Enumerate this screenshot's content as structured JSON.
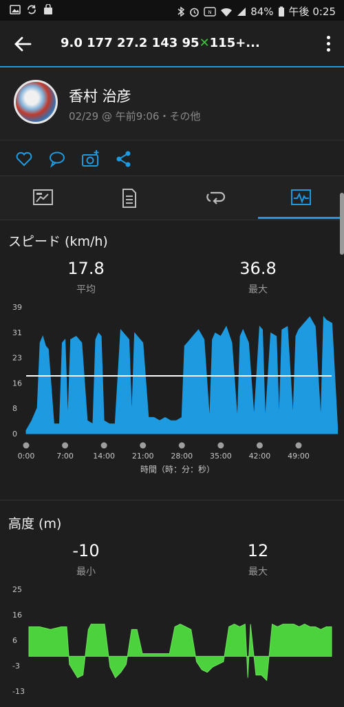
{
  "status_bar": {
    "battery": "84%",
    "time": "午後 0:25",
    "left_icons": [
      "image-icon",
      "sync-icon",
      "bag-icon"
    ],
    "right_icons": [
      "bluetooth-icon",
      "alarm-icon",
      "nfc-icon",
      "wifi-icon",
      "signal-icon",
      "battery-icon"
    ]
  },
  "app_bar": {
    "title_before": "9.0  177 27.2  143  95",
    "title_mark": "✕",
    "title_after": "115+...",
    "colors": {
      "accent": "#1e9be0",
      "mark": "#3cc43c"
    }
  },
  "profile": {
    "name": "香村 治彦",
    "meta": "02/29 @ 午前9:06・その他"
  },
  "actions": [
    "heart-icon",
    "comment-icon",
    "camera-add-icon",
    "share-icon"
  ],
  "tabs": [
    {
      "icon": "overview-icon",
      "active": false
    },
    {
      "icon": "details-icon",
      "active": false
    },
    {
      "icon": "laps-icon",
      "active": false
    },
    {
      "icon": "graphs-icon",
      "active": true
    }
  ],
  "speed": {
    "title": "スピード (km/h)",
    "avg_value": "17.8",
    "avg_label": "平均",
    "max_value": "36.8",
    "max_label": "最大",
    "x_axis_label": "時間（時：分：秒）",
    "color": "#1e9be0"
  },
  "altitude": {
    "title": "高度 (m)",
    "min_value": "-10",
    "min_label": "最小",
    "max_value": "12",
    "max_label": "最大",
    "color": "#4cd23c"
  },
  "chart_data": [
    {
      "type": "area",
      "ylim": [
        0,
        39
      ],
      "yticks": [
        "39",
        "31",
        "23",
        "16",
        "8",
        "0"
      ],
      "xticks": [
        "0:00",
        "7:00",
        "14:00",
        "21:00",
        "28:00",
        "35:00",
        "42:00",
        "49:00"
      ],
      "average_line": 17.8,
      "x_minutes": [
        0,
        1,
        2,
        2.5,
        3,
        3.5,
        4,
        5,
        6,
        6.5,
        7,
        7.5,
        8,
        9,
        10,
        11,
        12,
        12.5,
        13,
        13.5,
        14,
        15,
        16,
        17,
        18,
        18.5,
        19,
        19.5,
        20,
        21,
        22,
        23,
        24,
        25,
        26,
        27,
        28,
        28.5,
        29,
        30,
        31,
        32,
        33,
        33.5,
        34,
        35,
        36,
        37,
        38,
        38.5,
        39,
        40,
        41,
        42,
        42.5,
        43,
        44,
        45,
        45.5,
        46,
        47,
        48,
        48.5,
        49,
        50,
        51,
        52,
        53,
        53.5,
        54,
        55,
        56
      ],
      "values": [
        1,
        4,
        8,
        28,
        30,
        27,
        26,
        3,
        3,
        28,
        29,
        4,
        29,
        30,
        28,
        4,
        3,
        29,
        31,
        30,
        4,
        3,
        3,
        32,
        30,
        29,
        5,
        31,
        30,
        28,
        5,
        5,
        4,
        5,
        4,
        4,
        5,
        27,
        28,
        30,
        32,
        29,
        4,
        29,
        31,
        30,
        33,
        28,
        4,
        30,
        32,
        28,
        5,
        33,
        32,
        4,
        31,
        30,
        4,
        32,
        33,
        5,
        30,
        32,
        34,
        36,
        33,
        4,
        36,
        35,
        34,
        2
      ]
    },
    {
      "type": "area",
      "ylim": [
        -13,
        25
      ],
      "yticks": [
        "25",
        "16",
        "6",
        "-3",
        "-13"
      ],
      "x_minutes": [
        0,
        2,
        4,
        6,
        7,
        7.5,
        9,
        10,
        11,
        11.5,
        13,
        14,
        15,
        16,
        17,
        18,
        19,
        20,
        21,
        22,
        23,
        24,
        25,
        26,
        27,
        28,
        29,
        30,
        31,
        32,
        33,
        34,
        35,
        36,
        37,
        38,
        39,
        40,
        40.5,
        41,
        42,
        43,
        44,
        45,
        46,
        47,
        48,
        49,
        50,
        51,
        52,
        53,
        54,
        55,
        56
      ],
      "values": [
        11,
        11,
        10,
        11,
        11,
        -3,
        -8,
        -7,
        10,
        12,
        12,
        12,
        -4,
        -8,
        -6,
        -3,
        10,
        10,
        1,
        1,
        1,
        1,
        1,
        1,
        11,
        12,
        11,
        10,
        -2,
        -5,
        -6,
        -4,
        -3,
        -2,
        11,
        12,
        11,
        12,
        -8,
        12,
        -7,
        -7,
        -9,
        12,
        11,
        12,
        12,
        12,
        11,
        12,
        11,
        11,
        10,
        11,
        11
      ]
    }
  ]
}
